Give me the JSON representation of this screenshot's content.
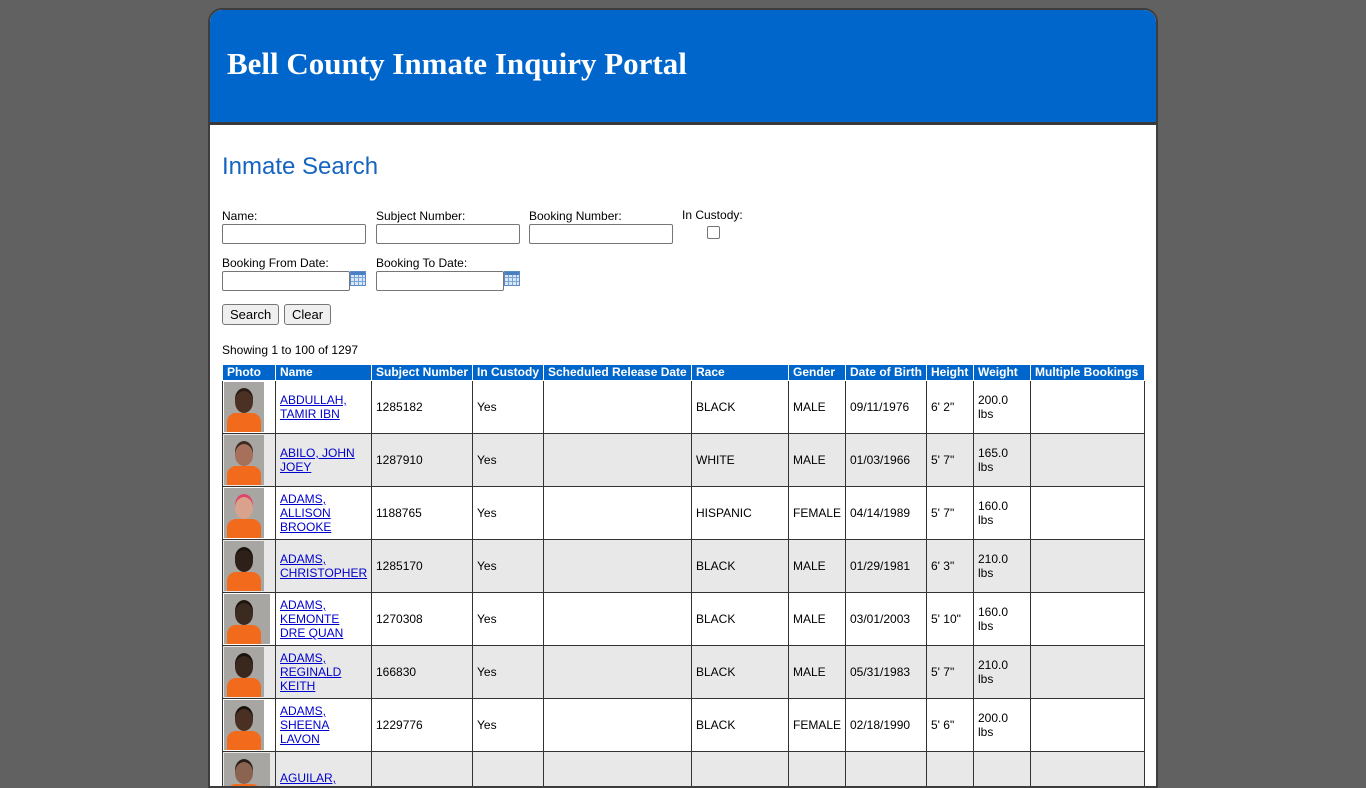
{
  "portal": {
    "title": "Bell County Inmate Inquiry Portal"
  },
  "search": {
    "title": "Inmate Search",
    "name_label": "Name:",
    "subject_label": "Subject Number:",
    "booking_label": "Booking Number:",
    "custody_label": "In Custody:",
    "from_label": "Booking From Date:",
    "to_label": "Booking To Date:",
    "search_button": "Search",
    "clear_button": "Clear",
    "name_value": "",
    "subject_value": "",
    "booking_value": "",
    "from_value": "",
    "to_value": "",
    "in_custody_checked": false
  },
  "results": {
    "summary": "Showing 1 to 100 of 1297",
    "columns": [
      "Photo",
      "Name",
      "Subject Number",
      "In Custody",
      "Scheduled Release Date",
      "Race",
      "Gender",
      "Date of Birth",
      "Height",
      "Weight",
      "Multiple Bookings"
    ],
    "rows": [
      {
        "name_line1": "ABDULLAH,",
        "name_line2": "TAMIR IBN",
        "name_line3": "",
        "subject": "1285182",
        "custody": "Yes",
        "release": "",
        "race": "BLACK",
        "gender": "MALE",
        "dob": "09/11/1976",
        "height": "6' 2\"",
        "weight": "200.0 lbs",
        "multiple": "",
        "skin": "#4a3124",
        "hair": "#2a1c14"
      },
      {
        "name_line1": "ABILO, JOHN",
        "name_line2": "JOEY",
        "name_line3": "",
        "subject": "1287910",
        "custody": "Yes",
        "release": "",
        "race": "WHITE",
        "gender": "MALE",
        "dob": "01/03/1966",
        "height": "5' 7\"",
        "weight": "165.0 lbs",
        "multiple": "",
        "skin": "#a6705a",
        "hair": "#3b2a22"
      },
      {
        "name_line1": "ADAMS,",
        "name_line2": "ALLISON",
        "name_line3": "BROOKE",
        "subject": "1188765",
        "custody": "Yes",
        "release": "",
        "race": "HISPANIC",
        "gender": "FEMALE",
        "dob": "04/14/1989",
        "height": "5' 7\"",
        "weight": "160.0 lbs",
        "multiple": "",
        "skin": "#d9a28c",
        "hair": "#e0436a"
      },
      {
        "name_line1": "ADAMS,",
        "name_line2": "CHRISTOPHER",
        "name_line3": "",
        "subject": "1285170",
        "custody": "Yes",
        "release": "",
        "race": "BLACK",
        "gender": "MALE",
        "dob": "01/29/1981",
        "height": "6' 3\"",
        "weight": "210.0 lbs",
        "multiple": "",
        "skin": "#2e2019",
        "hair": "#1a120d"
      },
      {
        "name_line1": "ADAMS,",
        "name_line2": "KEMONTE",
        "name_line3": "DRE QUAN",
        "subject": "1270308",
        "custody": "Yes",
        "release": "",
        "race": "BLACK",
        "gender": "MALE",
        "dob": "03/01/2003",
        "height": "5' 10\"",
        "weight": "160.0 lbs",
        "multiple": "",
        "skin": "#3a2a20",
        "hair": "#1d140f"
      },
      {
        "name_line1": "ADAMS,",
        "name_line2": "REGINALD",
        "name_line3": "KEITH",
        "subject": "166830",
        "custody": "Yes",
        "release": "",
        "race": "BLACK",
        "gender": "MALE",
        "dob": "05/31/1983",
        "height": "5' 7\"",
        "weight": "210.0 lbs",
        "multiple": "",
        "skin": "#3a271d",
        "hair": "#1a120d"
      },
      {
        "name_line1": "ADAMS,",
        "name_line2": "SHEENA",
        "name_line3": "LAVON",
        "subject": "1229776",
        "custody": "Yes",
        "release": "",
        "race": "BLACK",
        "gender": "FEMALE",
        "dob": "02/18/1990",
        "height": "5' 6\"",
        "weight": "200.0 lbs",
        "multiple": "",
        "skin": "#4a3022",
        "hair": "#1a120d"
      },
      {
        "name_line1": "AGUILAR,",
        "name_line2": "",
        "name_line3": "",
        "subject": "",
        "custody": "",
        "release": "",
        "race": "",
        "gender": "",
        "dob": "",
        "height": "",
        "weight": "",
        "multiple": "",
        "skin": "#8a6450",
        "hair": "#2a1d16"
      }
    ]
  },
  "colors": {
    "header_blue": "#0066cc",
    "title_blue": "#1565c0",
    "background": "#616161"
  },
  "icons": {
    "calendar": "calendar-icon"
  }
}
